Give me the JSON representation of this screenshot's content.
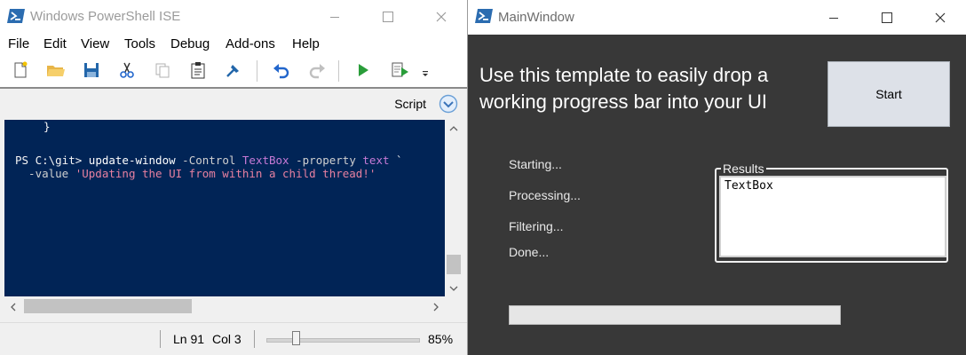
{
  "ise": {
    "title": "Windows PowerShell ISE",
    "menu": [
      "File",
      "Edit",
      "View",
      "Tools",
      "Debug",
      "Add-ons",
      "Help"
    ],
    "toolbar_icons": [
      "new-file-icon",
      "open-folder-icon",
      "save-icon",
      "cut-icon",
      "copy-icon",
      "paste-icon",
      "clear-console-icon",
      "undo-icon",
      "redo-icon",
      "run-script-icon",
      "run-selection-icon",
      "toolbar-overflow-icon"
    ],
    "script_label": "Script",
    "code": {
      "line1": "}",
      "prompt": "PS C:\\git> ",
      "command": "update-window",
      "param1": " -Control ",
      "arg1": "TextBox",
      "param2": " -property ",
      "arg2": "text",
      "continuation": " `",
      "param3": "  -value ",
      "string": "'Updating the UI from within a child thread!'"
    },
    "status": {
      "line": "Ln 91",
      "col": "Col 3",
      "zoom": "85%",
      "zoom_slider_fraction": 0.17
    },
    "colors": {
      "editor_bg": "#012456",
      "text": "#f5f5f5",
      "param": "#d0d0d0",
      "arg": "#c67ad6",
      "string": "#e880a0",
      "command": "#ffffff"
    }
  },
  "main_window": {
    "title": "MainWindow",
    "heading": "Use this template to easily drop a working progress bar into your UI",
    "start_button": "Start",
    "steps": [
      "Starting...",
      "Processing...",
      "Filtering...",
      "Done..."
    ],
    "results_label": "Results",
    "results_text": "TextBox",
    "progress_fraction": 0.0
  }
}
